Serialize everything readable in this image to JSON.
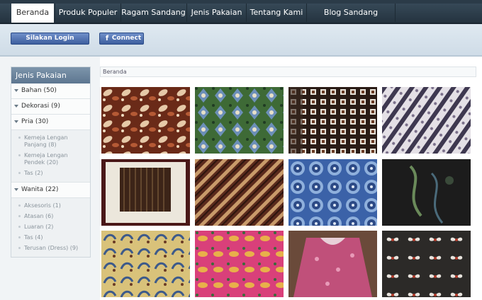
{
  "nav": {
    "items": [
      {
        "label": "Beranda",
        "active": true
      },
      {
        "label": "Produk Populer",
        "active": false
      },
      {
        "label": "Ragam Sandang",
        "active": false
      },
      {
        "label": "Jenis Pakaian",
        "active": false
      },
      {
        "label": "Tentang Kami",
        "active": false
      },
      {
        "label": "Blog Sandang Indonesia",
        "active": false
      }
    ]
  },
  "login": {
    "login_label": "Silakan Login",
    "connect_label": "Connect",
    "connect_icon": "facebook-icon"
  },
  "sidebar": {
    "title": "Jenis Pakaian",
    "categories": [
      {
        "label": "Bahan (50)"
      },
      {
        "label": "Dekorasi (9)"
      },
      {
        "label": "Pria (30)",
        "children": [
          "Kemeja Lengan Panjang (8)",
          "Kemeja Lengan Pendek (20)",
          "Tas (2)"
        ]
      },
      {
        "label": "Wanita (22)",
        "children": [
          "Aksesoris (1)",
          "Atasan (6)",
          "Luaran (2)",
          "Tas (4)",
          "Terusan (Dress) (9)"
        ]
      }
    ]
  },
  "breadcrumb": "Beranda",
  "colors": {
    "nav_bg": "#2c3d4a",
    "accent": "#5d7690",
    "login_btn": "#4a6aa9"
  }
}
